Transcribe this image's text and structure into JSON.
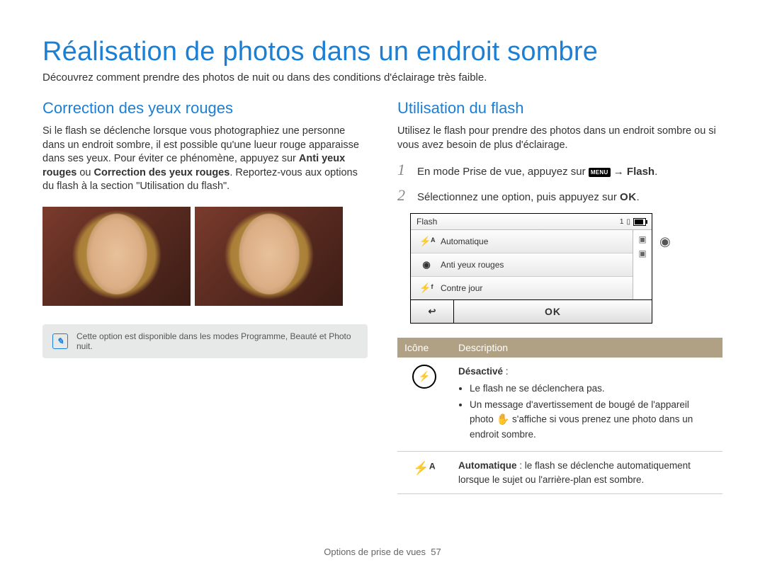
{
  "page": {
    "title": "Réalisation de photos dans un endroit sombre",
    "subtitle": "Découvrez comment prendre des photos de nuit ou dans des conditions d'éclairage très faible."
  },
  "left": {
    "heading": "Correction des yeux rouges",
    "para_a": "Si le flash se déclenche lorsque vous photographiez une personne dans un endroit sombre, il est possible qu'une lueur rouge apparaisse dans ses yeux. Pour éviter ce phénomène, appuyez sur ",
    "para_b_bold1": "Anti yeux rouges",
    "para_c": " ou ",
    "para_b_bold2": "Correction des yeux rouges",
    "para_d": ". Reportez-vous aux options du flash à la section \"Utilisation du flash\".",
    "note": "Cette option est disponible dans les modes Programme, Beauté et Photo nuit."
  },
  "right": {
    "heading": "Utilisation du flash",
    "intro": "Utilisez le flash pour prendre des photos dans un endroit sombre ou si vous avez besoin de plus d'éclairage.",
    "step1_a": "En mode Prise de vue, appuyez sur ",
    "step1_menu": "MENU",
    "step1_b": " → ",
    "step1_bold": "Flash",
    "step1_c": ".",
    "step2_a": "Sélectionnez une option, puis appuyez sur ",
    "step2_ok": "OK",
    "step2_b": "."
  },
  "lcd": {
    "title": "Flash",
    "count": "1",
    "items": [
      {
        "icon": "⚡ᴬ",
        "label": "Automatique"
      },
      {
        "icon": "◉",
        "label": "Anti yeux rouges"
      },
      {
        "icon": "⚡ᶠ",
        "label": "Contre jour"
      }
    ],
    "back": "↩",
    "ok": "OK"
  },
  "table": {
    "head_icon": "Icône",
    "head_desc": "Description",
    "row1": {
      "title": "Désactivé",
      "sep": " :",
      "b1": "Le flash ne se déclenchera pas.",
      "b2a": "Un message d'avertissement de bougé de l'appareil photo ",
      "b2b": " s'affiche si vous prenez une photo dans un endroit sombre."
    },
    "row2": {
      "title": "Automatique",
      "rest": " : le flash se déclenche automatiquement lorsque le sujet ou l'arrière-plan est sombre."
    }
  },
  "footer": {
    "section": "Options de prise de vues",
    "page_num": "57"
  }
}
